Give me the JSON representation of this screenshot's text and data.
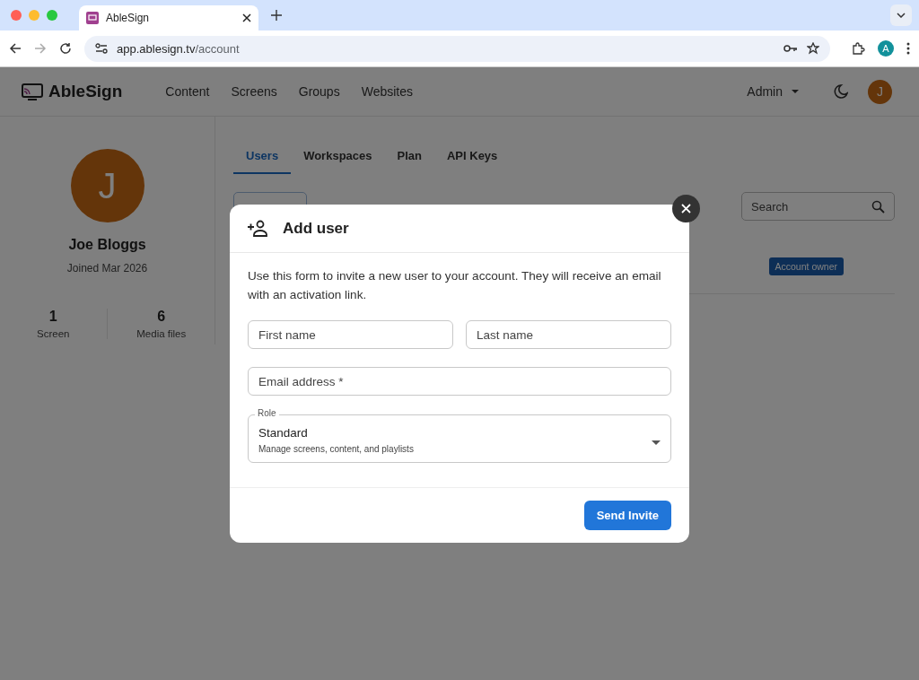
{
  "browser": {
    "tab_title": "AbleSign",
    "url_host": "app.ablesign.tv",
    "url_path": "/account",
    "profile_initial": "A"
  },
  "header": {
    "logo": "AbleSign",
    "nav": [
      {
        "label": "Content"
      },
      {
        "label": "Screens"
      },
      {
        "label": "Groups"
      },
      {
        "label": "Websites"
      }
    ],
    "menu": "Admin",
    "avatar_initial": "J"
  },
  "profile": {
    "initial": "J",
    "name": "Joe Bloggs",
    "joined": "Joined Mar 2026",
    "stats": [
      {
        "value": "1",
        "label": "Screen"
      },
      {
        "value": "6",
        "label": "Media files"
      }
    ]
  },
  "tabs": [
    {
      "label": "Users",
      "selected": true
    },
    {
      "label": "Workspaces",
      "selected": false
    },
    {
      "label": "Plan",
      "selected": false
    },
    {
      "label": "API Keys",
      "selected": false
    }
  ],
  "search": {
    "placeholder": "Search"
  },
  "users_table": {
    "badge": "Account owner"
  },
  "dialog": {
    "title": "Add user",
    "description": "Use this form to invite a new user to your account. They will receive an email with an activation link.",
    "first_name": {
      "placeholder": "First name"
    },
    "last_name": {
      "placeholder": "Last name"
    },
    "email": {
      "placeholder": "Email address *"
    },
    "role": {
      "label": "Role",
      "value": "Standard",
      "hint": "Manage screens, content, and playlists"
    },
    "submit": "Send Invite"
  }
}
